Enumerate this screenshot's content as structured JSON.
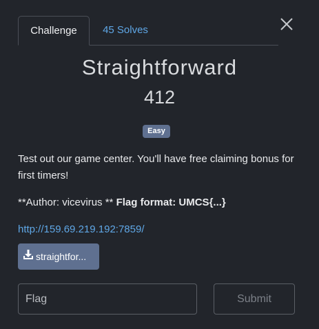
{
  "tabs": [
    {
      "label": "Challenge"
    },
    {
      "label": "45 Solves"
    }
  ],
  "challenge": {
    "name": "Straightforward",
    "points": "412",
    "difficulty": "Easy",
    "description": "Test out our game center. You'll have free claiming bonus for first timers!",
    "author_prefix": "**Author: vicevirus ** ",
    "flag_format": "Flag format: UMCS{...}",
    "link": "http://159.69.219.192:7859/",
    "file_label": "straightfor..."
  },
  "form": {
    "flag_placeholder": "Flag",
    "submit_label": "Submit"
  },
  "icons": {
    "close": "close-icon",
    "download": "download-icon"
  },
  "colors": {
    "background": "#22252b",
    "link": "#5fa7e6",
    "badge": "#5f7090",
    "text": "#e9eaec"
  }
}
